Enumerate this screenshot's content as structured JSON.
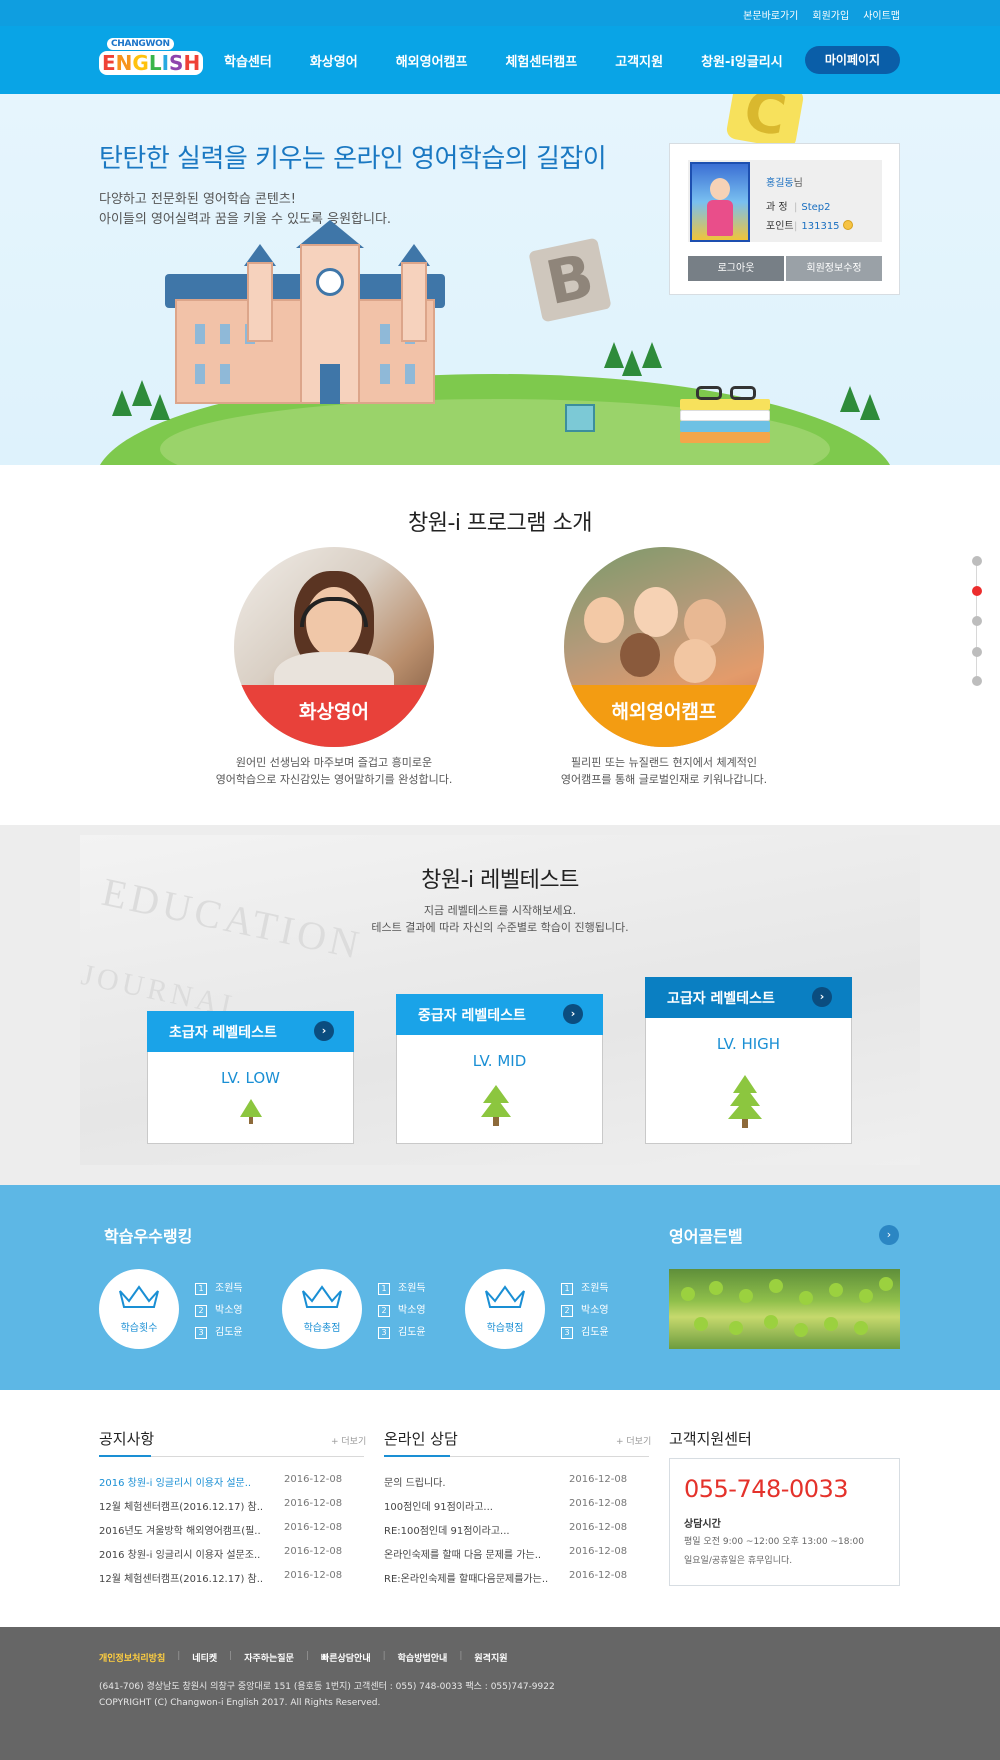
{
  "top_links": [
    "본문바로가기",
    "회원가입",
    "사이트맵"
  ],
  "logo": {
    "top": "CHANGWON",
    "bottom": "ENGLISH"
  },
  "menu": [
    "학습센터",
    "화상영어",
    "해외영어캠프",
    "체험센터캠프",
    "고객지원",
    "창원-i잉글리시"
  ],
  "mypage_label": "마이페이지",
  "hero": {
    "title": "탄탄한 실력을 키우는 온라인 영어학습의 길잡이",
    "sub1": "다양하고 전문화된 영어학습 콘텐츠!",
    "sub2": "아이들의 영어실력과 꿈을 키울 수 있도록 응원합니다.",
    "letter_b": "B",
    "letter_c": "C"
  },
  "user": {
    "name": "홍길동",
    "name_suffix": "님",
    "course_label": "과 정",
    "course_value": "Step2",
    "point_label": "포인트",
    "point_value": "131315",
    "logout_label": "로그아웃",
    "edit_label": "회원정보수정"
  },
  "program": {
    "title": "창원-i 프로그램 소개",
    "items": [
      {
        "label": "화상영어",
        "desc1": "원어민 선생님와 마주보며 즐겁고 흥미로운",
        "desc2": "영어학습으로 자신감있는 영어말하기를 완성합니다.",
        "color": "#e8413a"
      },
      {
        "label": "해외영어캠프",
        "desc1": "필리핀 또는 뉴질랜드 현지에서 체계적인",
        "desc2": "영어캠프를 통해  글로벌인재로 키워나갑니다.",
        "color": "#f39c12"
      }
    ]
  },
  "level": {
    "title": "창원-i 레벨테스트",
    "sub1": "지금 레벨테스트를 시작해보세요.",
    "sub2": "테스트 결과에 따라 자신의 수준별로 학습이 진행됩니다.",
    "cards": [
      {
        "title": "초급자 레벨테스트",
        "level": "LV. LOW",
        "color": "#1aa3e8"
      },
      {
        "title": "중급자 레벨테스트",
        "level": "LV. MID",
        "color": "#1aa3e8"
      },
      {
        "title": "고급자 레벨테스트",
        "level": "LV. HIGH",
        "color": "#0a7fc2"
      }
    ],
    "arrow": "›"
  },
  "ranking": {
    "title": "학습우수랭킹",
    "groups": [
      {
        "label": "학습횟수",
        "names": [
          "조원득",
          "박소영",
          "김도윤"
        ]
      },
      {
        "label": "학습총점",
        "names": [
          "조원득",
          "박소영",
          "김도윤"
        ]
      },
      {
        "label": "학습평점",
        "names": [
          "조원득",
          "박소영",
          "김도윤"
        ]
      }
    ],
    "gold_title": "영어골든벨",
    "arrow": "›"
  },
  "notice": {
    "title": "공지사항",
    "more": "+ 더보기",
    "rows": [
      {
        "title": "2016 창원-i 잉글리시 이용자 설문..",
        "date": "2016-12-08"
      },
      {
        "title": "12월 체험센터캠프(2016.12.17) 참..",
        "date": "2016-12-08"
      },
      {
        "title": "2016년도 겨울방학 해외영어캠프(필..",
        "date": "2016-12-08"
      },
      {
        "title": "2016 창원-i 잉글리시 이용자 설문조..",
        "date": "2016-12-08"
      },
      {
        "title": "12월 체험센터캠프(2016.12.17) 참..",
        "date": "2016-12-08"
      }
    ]
  },
  "consult": {
    "title": "온라인 상담",
    "more": "+ 더보기",
    "rows": [
      {
        "title": "문의 드립니다.",
        "date": "2016-12-08"
      },
      {
        "title": "100점인데 91점이라고...",
        "date": "2016-12-08"
      },
      {
        "title": "RE:100점인데 91점이라고...",
        "date": "2016-12-08"
      },
      {
        "title": "온라인숙제를 할때 다음 문제를 가는..",
        "date": "2016-12-08"
      },
      {
        "title": "RE:온라인숙제를 할때다음문제를가는..",
        "date": "2016-12-08"
      }
    ]
  },
  "cs": {
    "title": "고객지원센터",
    "phone": "055-748-0033",
    "hours_label": "상담시간",
    "hours1": "평일 오전 9:00 ~12:00  오후 13:00 ~18:00",
    "hours2": "일요일/공휴일은 휴무입니다."
  },
  "footer": {
    "links": [
      "개인정보처리방침",
      "네티켓",
      "자주하는질문",
      "빠른상담안내",
      "학습방법안내",
      "원격지원"
    ],
    "address": "(641-706) 경상남도 창원시 의창구 중앙대로 151 (용호동 1번지)    고객센터 : 055) 748-0033    팩스 : 055)747-9922",
    "copyright": "COPYRIGHT (C) Changwon-i English 2017. All Rights Reserved.",
    "accent": "#ffcf40"
  },
  "colors": {
    "primary": "#09a4e6",
    "dark": "#0a5ea8",
    "rank_bg": "#5db7e5",
    "footer_bg": "#666666"
  },
  "icons": [
    "crown-icon",
    "arrow-right-icon",
    "tree-icon",
    "coin-icon"
  ]
}
